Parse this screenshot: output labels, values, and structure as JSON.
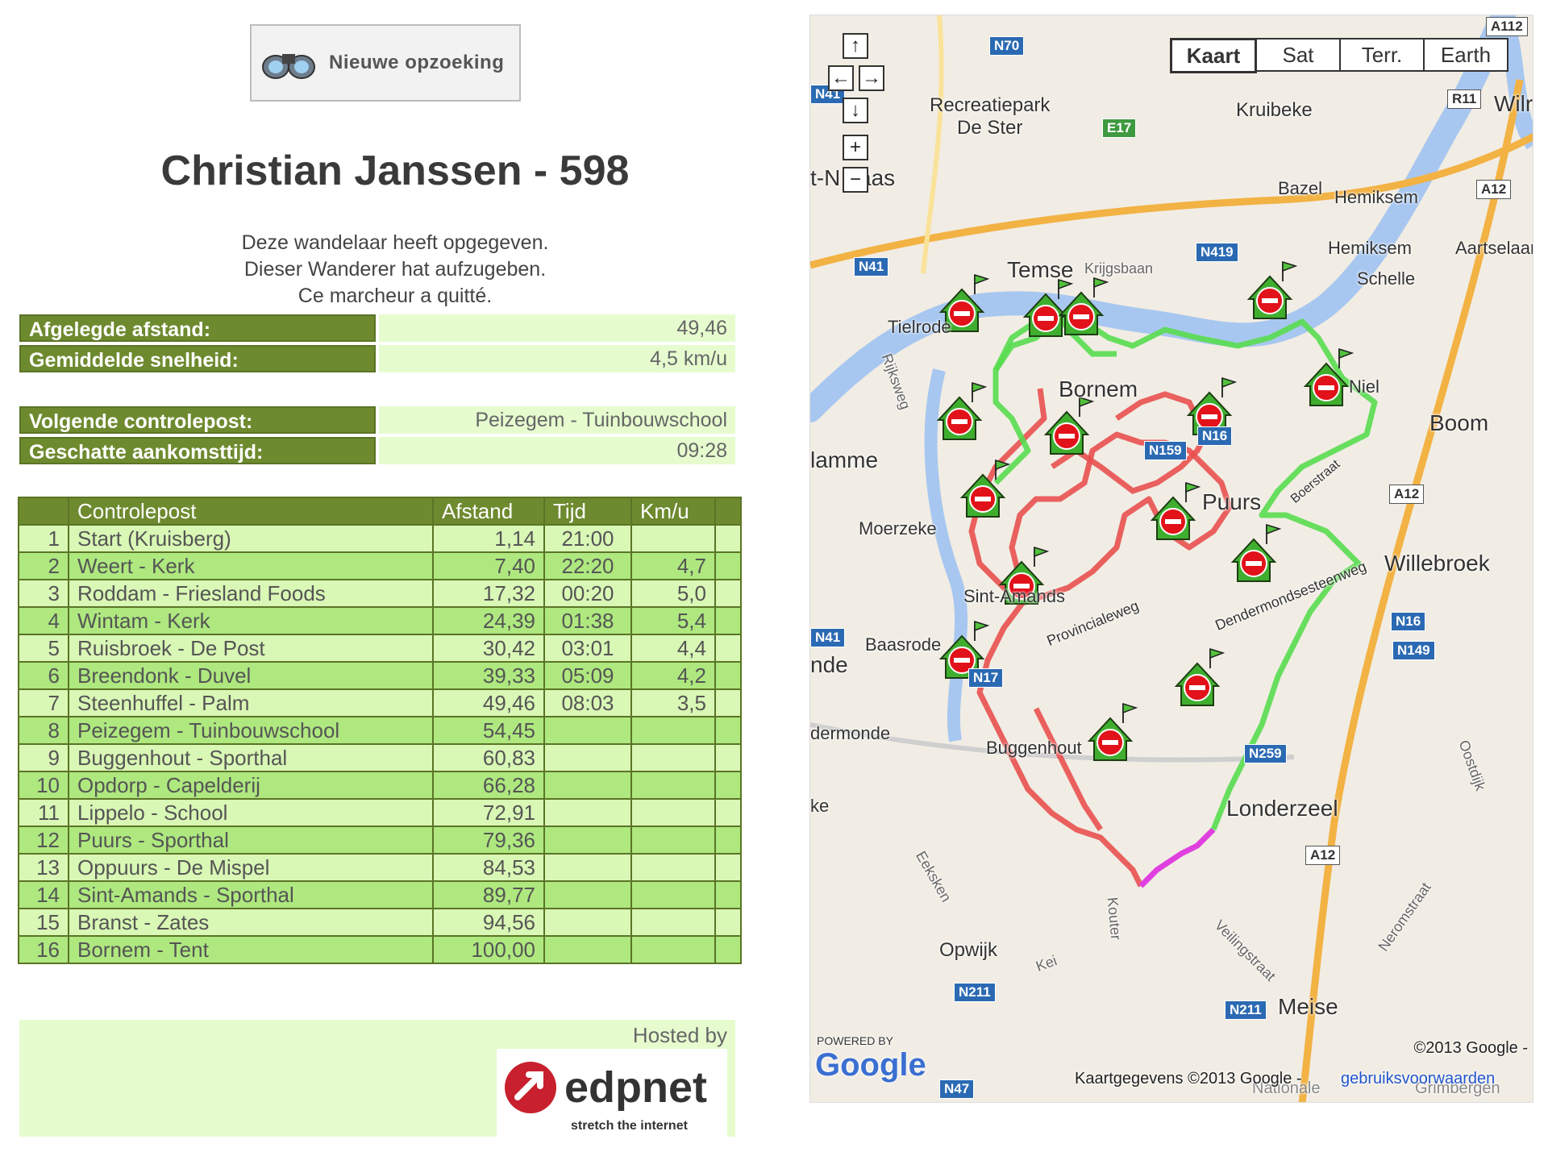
{
  "search_button": {
    "label": "Nieuwe opzoeking",
    "icon": "binoculars-icon"
  },
  "walker": {
    "title": "Christian Janssen - 598"
  },
  "messages": [
    "Deze wandelaar heeft opgegeven.",
    "Dieser Wanderer hat aufzugeben.",
    "Ce marcheur a quitté."
  ],
  "stats": [
    {
      "label": "Afgelegde afstand:",
      "value": "49,46"
    },
    {
      "label": "Gemiddelde snelheid:",
      "value": "4,5 km/u"
    }
  ],
  "next": [
    {
      "label": "Volgende controlepost:",
      "value": "Peizegem - Tuinbouwschool"
    },
    {
      "label": "Geschatte aankomsttijd:",
      "value": "09:28"
    }
  ],
  "table": {
    "headers": [
      "",
      "Controlepost",
      "Afstand",
      "Tijd",
      "Km/u",
      ""
    ],
    "rows": [
      [
        "1",
        "Start (Kruisberg)",
        "1,14",
        "21:00",
        ""
      ],
      [
        "2",
        "Weert - Kerk",
        "7,40",
        "22:20",
        "4,7"
      ],
      [
        "3",
        "Roddam - Friesland Foods",
        "17,32",
        "00:20",
        "5,0"
      ],
      [
        "4",
        "Wintam - Kerk",
        "24,39",
        "01:38",
        "5,4"
      ],
      [
        "5",
        "Ruisbroek - De Post",
        "30,42",
        "03:01",
        "4,4"
      ],
      [
        "6",
        "Breendonk - Duvel",
        "39,33",
        "05:09",
        "4,2"
      ],
      [
        "7",
        "Steenhuffel - Palm",
        "49,46",
        "08:03",
        "3,5"
      ],
      [
        "8",
        "Peizegem - Tuinbouwschool",
        "54,45",
        "",
        ""
      ],
      [
        "9",
        "Buggenhout - Sporthal",
        "60,83",
        "",
        ""
      ],
      [
        "10",
        "Opdorp - Capelderij",
        "66,28",
        "",
        ""
      ],
      [
        "11",
        "Lippelo - School",
        "72,91",
        "",
        ""
      ],
      [
        "12",
        "Puurs - Sporthal",
        "79,36",
        "",
        ""
      ],
      [
        "13",
        "Oppuurs - De Mispel",
        "84,53",
        "",
        ""
      ],
      [
        "14",
        "Sint-Amands - Sporthal",
        "89,77",
        "",
        ""
      ],
      [
        "15",
        "Branst - Zates",
        "94,56",
        "",
        ""
      ],
      [
        "16",
        "Bornem - Tent",
        "100,00",
        "",
        ""
      ]
    ]
  },
  "hosted": {
    "text": "Hosted by",
    "brand": "edpnet",
    "tagline": "stretch the internet"
  },
  "map": {
    "types": [
      "Kaart",
      "Sat",
      "Terr.",
      "Earth"
    ],
    "active_type": "Kaart",
    "places": [
      "Recreatiepark De Ster",
      "Kruibeke",
      "Bazel",
      "Hemiksem",
      "Hemiksem",
      "Aartselaar",
      "Schelle",
      "Temse",
      "Krijgsbaan",
      "Tielrode",
      "Niel",
      "Boom",
      "Hamme",
      "Moerzeke",
      "Puurs",
      "Willebroek",
      "Sint-Amands",
      "Baasrode",
      "Londerzeel",
      "Opwijk",
      "Meise",
      "Buggenhout",
      "Dendermonde",
      "Bornem",
      "Rijksweg",
      "Nationale",
      "Grimbergen",
      "A112",
      "Wilr",
      "t-N",
      "aas",
      "nde",
      "ke",
      "Kei",
      "Kouter",
      "Eeksken",
      "Veilingstraat",
      "Neromstraat",
      "Oostdijk",
      "Provincialeweg",
      "Dendermondsesteenweg",
      "Boerstraat"
    ],
    "roads": [
      "N70",
      "E17",
      "R11",
      "A12",
      "N419",
      "N41",
      "N159",
      "N16",
      "A12",
      "N16",
      "N149",
      "N17",
      "N259",
      "A12",
      "N211",
      "N211",
      "N47",
      "N41",
      "N41"
    ],
    "powered_by": "POWERED BY",
    "google": "Google",
    "copyright": "©2013 Google -",
    "mapdata": "Kaartgegevens ©2013 Google -",
    "terms": "gebruiksvoorwaarden",
    "nav": [
      "↑",
      "←",
      "→",
      "↓",
      "+",
      "−"
    ],
    "colors": {
      "done": "#e8504f",
      "todo": "#58dc4f",
      "current": "#e040e0"
    }
  }
}
